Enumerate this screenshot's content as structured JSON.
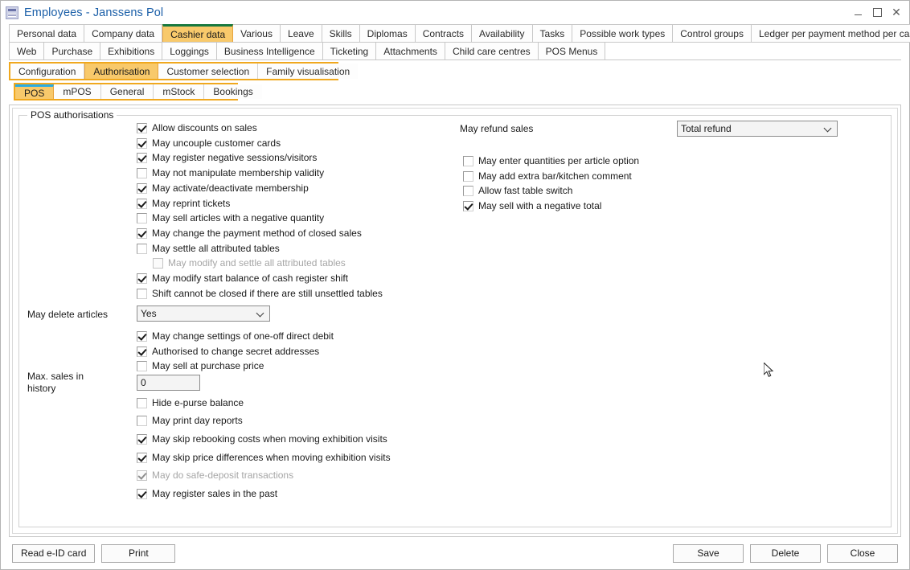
{
  "window": {
    "title": "Employees - Janssens Pol",
    "icon": "document-icon",
    "controls": {
      "minimize": "minimize-icon",
      "maximize": "maximize-icon",
      "close": "close-icon"
    }
  },
  "tabs_row1": [
    {
      "label": "Personal data",
      "selected": false
    },
    {
      "label": "Company data",
      "selected": false
    },
    {
      "label": "Cashier data",
      "selected": true
    },
    {
      "label": "Various",
      "selected": false
    },
    {
      "label": "Leave",
      "selected": false
    },
    {
      "label": "Skills",
      "selected": false
    },
    {
      "label": "Diplomas",
      "selected": false
    },
    {
      "label": "Contracts",
      "selected": false
    },
    {
      "label": "Availability",
      "selected": false
    },
    {
      "label": "Tasks",
      "selected": false
    },
    {
      "label": "Possible work types",
      "selected": false
    },
    {
      "label": "Control groups",
      "selected": false
    },
    {
      "label": "Ledger per payment method per cashier",
      "selected": false
    }
  ],
  "tabs_row2": [
    {
      "label": "Web",
      "selected": false
    },
    {
      "label": "Purchase",
      "selected": false
    },
    {
      "label": "Exhibitions",
      "selected": false
    },
    {
      "label": "Loggings",
      "selected": false
    },
    {
      "label": "Business Intelligence",
      "selected": false
    },
    {
      "label": "Ticketing",
      "selected": false
    },
    {
      "label": "Attachments",
      "selected": false
    },
    {
      "label": "Child care centres",
      "selected": false
    },
    {
      "label": "POS Menus",
      "selected": false
    }
  ],
  "tabs_row3": [
    {
      "label": "Configuration",
      "selected": false
    },
    {
      "label": "Authorisation",
      "selected": true
    },
    {
      "label": "Customer selection",
      "selected": false
    },
    {
      "label": "Family visualisation",
      "selected": false
    }
  ],
  "tabs_row4": [
    {
      "label": "POS",
      "selected": true
    },
    {
      "label": "mPOS",
      "selected": false
    },
    {
      "label": "General",
      "selected": false
    },
    {
      "label": "mStock",
      "selected": false
    },
    {
      "label": "Bookings",
      "selected": false
    }
  ],
  "groupbox": {
    "legend": "POS authorisations"
  },
  "left_column": {
    "checkboxes": [
      {
        "label": "Allow discounts on sales",
        "checked": true,
        "disabled": false
      },
      {
        "label": "May uncouple customer cards",
        "checked": true,
        "disabled": false
      },
      {
        "label": "May register negative sessions/visitors",
        "checked": true,
        "disabled": false
      },
      {
        "label": "May not manipulate membership validity",
        "checked": false,
        "disabled": false
      },
      {
        "label": "May activate/deactivate membership",
        "checked": true,
        "disabled": false
      },
      {
        "label": "May reprint tickets",
        "checked": true,
        "disabled": false
      },
      {
        "label": "May sell articles with a negative quantity",
        "checked": false,
        "disabled": false
      },
      {
        "label": "May change the payment method of closed sales",
        "checked": true,
        "disabled": false
      },
      {
        "label": "May settle all attributed tables",
        "checked": false,
        "disabled": false
      },
      {
        "label": "May modify and settle all attributed tables",
        "checked": false,
        "disabled": true,
        "indent": true
      },
      {
        "label": "May modify start balance of cash register shift",
        "checked": true,
        "disabled": false
      },
      {
        "label": "Shift cannot be closed if there are still unsettled tables",
        "checked": false,
        "disabled": false
      }
    ],
    "may_delete_articles": {
      "label": "May delete articles",
      "value": "Yes"
    },
    "checkboxes2": [
      {
        "label": "May change settings of one-off direct debit",
        "checked": true,
        "disabled": false
      },
      {
        "label": "Authorised to change secret addresses",
        "checked": true,
        "disabled": false
      },
      {
        "label": "May sell at purchase price",
        "checked": false,
        "disabled": false
      }
    ],
    "max_sales_in_history": {
      "label": "Max. sales in history",
      "value": "0"
    },
    "checkboxes3": [
      {
        "label": "Hide e-purse balance",
        "checked": false,
        "disabled": false
      },
      {
        "label": "May print day reports",
        "checked": false,
        "disabled": false
      },
      {
        "label": "May skip rebooking costs when moving exhibition visits",
        "checked": true,
        "disabled": false
      },
      {
        "label": "May skip price differences when moving exhibition visits",
        "checked": true,
        "disabled": false
      },
      {
        "label": "May do safe-deposit transactions",
        "checked": true,
        "disabled": true
      },
      {
        "label": "May register sales in the past",
        "checked": true,
        "disabled": false
      }
    ]
  },
  "right_column": {
    "may_refund_sales": {
      "label": "May refund sales",
      "value": "Total refund"
    },
    "checkboxes": [
      {
        "label": "May enter quantities per article option",
        "checked": false,
        "disabled": false
      },
      {
        "label": "May add extra bar/kitchen comment",
        "checked": false,
        "disabled": false
      },
      {
        "label": "Allow fast table switch",
        "checked": false,
        "disabled": false
      },
      {
        "label": "May sell with a negative total",
        "checked": true,
        "disabled": false
      }
    ]
  },
  "bottom_bar": {
    "left_buttons": [
      {
        "label": "Read e-ID card"
      },
      {
        "label": "Print"
      }
    ],
    "right_buttons": [
      {
        "label": "Save"
      },
      {
        "label": "Delete"
      },
      {
        "label": "Close"
      }
    ]
  },
  "colors": {
    "accent_orange": "#f0a81e",
    "tab_selected_fill": "#f8c96b",
    "cashier_tab_top": "#18793f",
    "pos_tab_top": "#2aace2",
    "title_text": "#1b5fa8"
  }
}
